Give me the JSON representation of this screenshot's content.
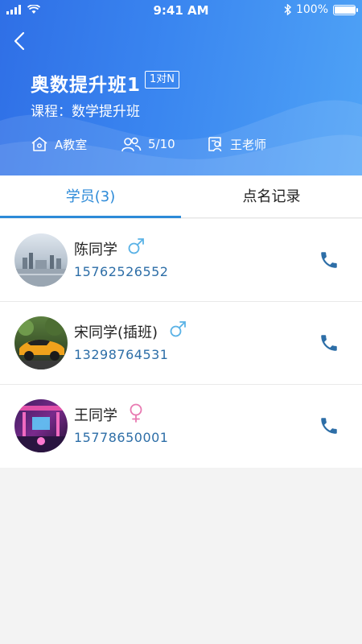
{
  "status_bar": {
    "time": "9:41 AM",
    "battery": "100%",
    "battery_level": 1.0
  },
  "header": {
    "title": "奥数提升班1",
    "badge": "1对N",
    "course_line": "课程：数学提升班",
    "room": "A教室",
    "enrollment": "5/10",
    "teacher": "王老师"
  },
  "tabs": [
    {
      "label": "学员(3)",
      "active": true
    },
    {
      "label": "点名记录",
      "active": false
    }
  ],
  "students": [
    {
      "name": "陈同学",
      "gender": "male",
      "phone": "15762526552"
    },
    {
      "name": "宋同学(插班)",
      "gender": "male",
      "phone": "13298764531"
    },
    {
      "name": "王同学",
      "gender": "female",
      "phone": "15778650001"
    }
  ],
  "colors": {
    "header_start": "#2f6fe6",
    "header_end": "#4fa3f6",
    "accent": "#2c8ad8",
    "phone_text": "#2d6ea7",
    "male": "#5ab2e6",
    "female": "#e879b1"
  }
}
